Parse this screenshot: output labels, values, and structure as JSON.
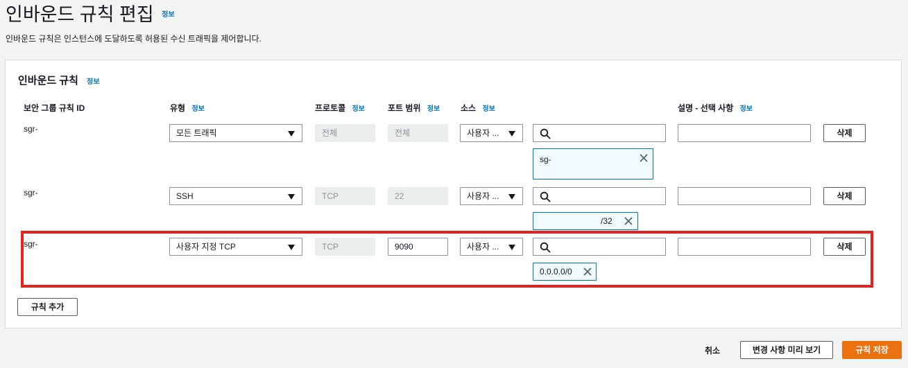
{
  "header": {
    "title": "인바운드 규칙 편집",
    "info": "정보",
    "description": "인바운드 규칙은 인스턴스에 도달하도록 허용된 수신 트래픽을 제어합니다."
  },
  "panel": {
    "title": "인바운드 규칙",
    "info": "정보",
    "columns": {
      "rule_id": "보안 그룹 규칙 ID",
      "type": "유형",
      "protocol": "프로토콜",
      "port_range": "포트 범위",
      "source": "소스",
      "description": "설명 - 선택 사항",
      "info": "정보"
    },
    "rules": [
      {
        "rule_id": "sgr-",
        "type": "모든 트래픽",
        "protocol": "전체",
        "port_range": "전체",
        "source_type": "사용자 ...",
        "search_value": "",
        "token": "sg-",
        "description": "",
        "delete_label": "삭제"
      },
      {
        "rule_id": "sgr-",
        "type": "SSH",
        "protocol": "TCP",
        "port_range": "22",
        "source_type": "사용자 ...",
        "search_value": "",
        "token": "/32",
        "description": "",
        "delete_label": "삭제"
      },
      {
        "rule_id": "sgr-",
        "type": "사용자 지정 TCP",
        "protocol": "TCP",
        "port_range": "9090",
        "source_type": "사용자 ...",
        "search_value": "",
        "token": "0.0.0.0/0",
        "description": "",
        "delete_label": "삭제"
      }
    ],
    "add_rule_label": "규칙 추가"
  },
  "footer": {
    "cancel_label": "취소",
    "preview_label": "변경 사항 미리 보기",
    "save_label": "규칙 저장"
  },
  "colors": {
    "accent": "#ec7211",
    "link": "#0073bb",
    "highlight": "#e8211f"
  }
}
